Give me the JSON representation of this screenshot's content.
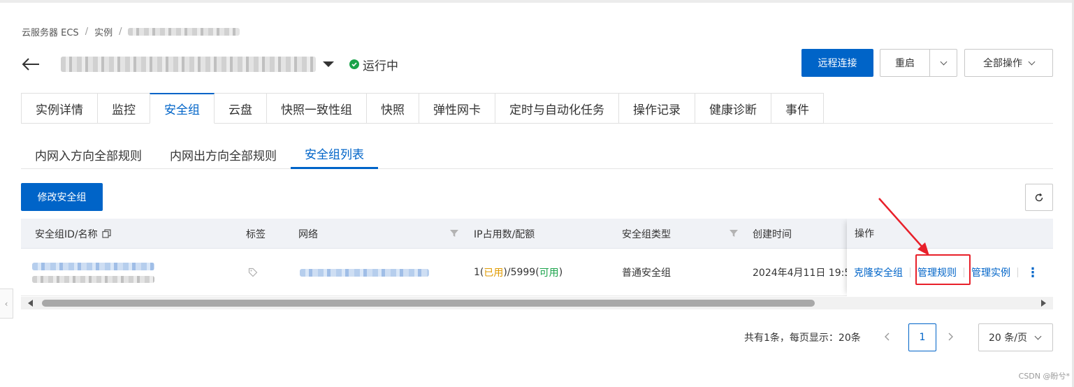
{
  "breadcrumb": {
    "items": [
      "云服务器 ECS",
      "实例"
    ],
    "separator": "/"
  },
  "header": {
    "status": "运行中"
  },
  "actions": {
    "remote_connect": "远程连接",
    "restart": "重启",
    "all_ops": "全部操作"
  },
  "tabs": [
    {
      "label": "实例详情",
      "active": false
    },
    {
      "label": "监控",
      "active": false
    },
    {
      "label": "安全组",
      "active": true
    },
    {
      "label": "云盘",
      "active": false
    },
    {
      "label": "快照一致性组",
      "active": false
    },
    {
      "label": "快照",
      "active": false
    },
    {
      "label": "弹性网卡",
      "active": false
    },
    {
      "label": "定时与自动化任务",
      "active": false
    },
    {
      "label": "操作记录",
      "active": false
    },
    {
      "label": "健康诊断",
      "active": false
    },
    {
      "label": "事件",
      "active": false
    }
  ],
  "subtabs": [
    {
      "label": "内网入方向全部规则",
      "active": false
    },
    {
      "label": "内网出方向全部规则",
      "active": false
    },
    {
      "label": "安全组列表",
      "active": true
    }
  ],
  "toolbar": {
    "modify": "修改安全组"
  },
  "table": {
    "columns": {
      "id": "安全组ID/名称",
      "tags": "标签",
      "network": "网络",
      "ip": "IP占用数/配额",
      "type": "安全组类型",
      "created": "创建时间",
      "ops": "操作"
    },
    "row": {
      "ip_used": "1",
      "ip_used_label": "已用",
      "ip_quota": "5999",
      "ip_available_label": "可用",
      "type": "普通安全组",
      "created": "2024年4月11日 19:5"
    },
    "ops": {
      "clone": "克隆安全组",
      "manage_rules": "管理规则",
      "manage_instances": "管理实例"
    }
  },
  "pagination": {
    "total_text": "共有1条，每页显示：20条",
    "current": "1",
    "page_size": "20 条/页"
  },
  "watermark": "CSDN @盼兮*",
  "colors": {
    "primary": "#0064c8",
    "running": "#1aa34a",
    "used": "#e09a00",
    "available": "#1aa34a",
    "annotation": "#e8202a"
  }
}
